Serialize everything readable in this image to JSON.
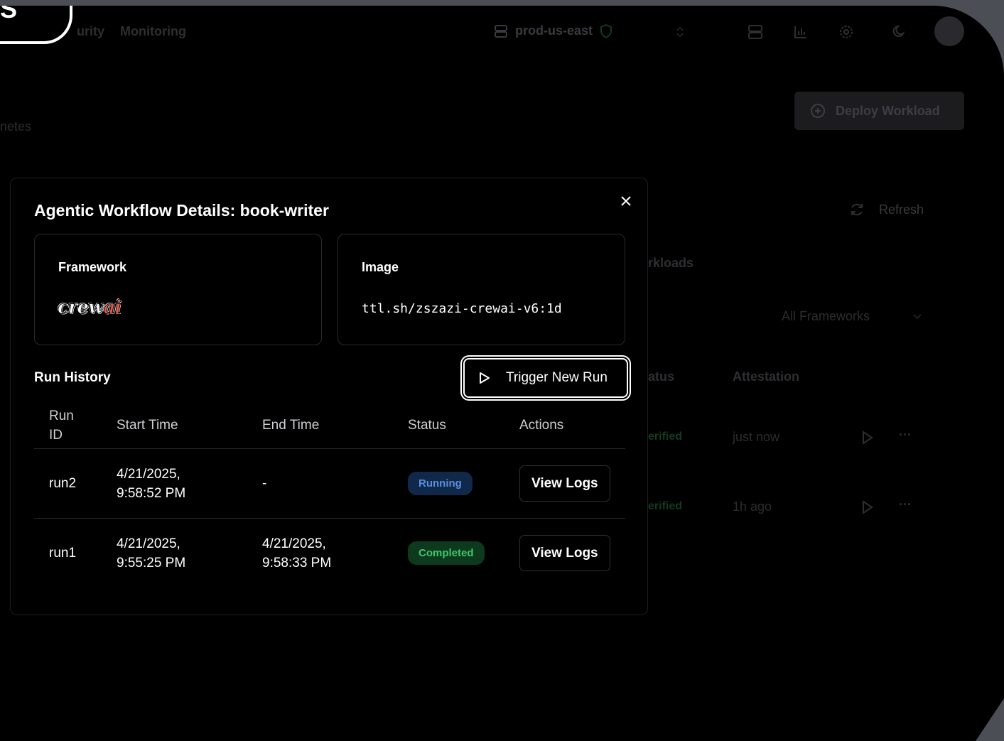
{
  "background": {
    "top_left_label": "S",
    "nav": [
      "urity",
      "Monitoring"
    ],
    "server": "prod-us-east",
    "deploy_label": "Deploy Workload",
    "left_text": "netes",
    "refresh_label": "Refresh",
    "workloads_text": "rkloads",
    "frameworks_select": "All Frameworks",
    "columns": [
      "atus",
      "Attestation"
    ],
    "rows": [
      {
        "status": "erified",
        "attestation": "just now"
      },
      {
        "status": "erified",
        "attestation": "1h ago"
      }
    ]
  },
  "modal": {
    "title": "Agentic Workflow Details: book-writer",
    "framework_label": "Framework",
    "framework_logo_text": "crew",
    "framework_logo_accent": "ai",
    "image_label": "Image",
    "image_value": "ttl.sh/zszazi-crewai-v6:1d",
    "run_history_label": "Run History",
    "trigger_label": "Trigger New Run",
    "table": {
      "headers": [
        "Run ID",
        "Start Time",
        "End Time",
        "Status",
        "Actions"
      ],
      "rows": [
        {
          "id": "run2",
          "start": "4/21/2025, 9:58:52 PM",
          "end": "-",
          "status": "Running",
          "action": "View Logs"
        },
        {
          "id": "run1",
          "start": "4/21/2025, 9:55:25 PM",
          "end": "4/21/2025, 9:58:33 PM",
          "status": "Completed",
          "action": "View Logs"
        }
      ]
    }
  },
  "colors": {
    "running_bg": "#10284a",
    "running_text": "#5b8ee0",
    "completed_bg": "#0d3a1c",
    "completed_text": "#43c46e"
  }
}
